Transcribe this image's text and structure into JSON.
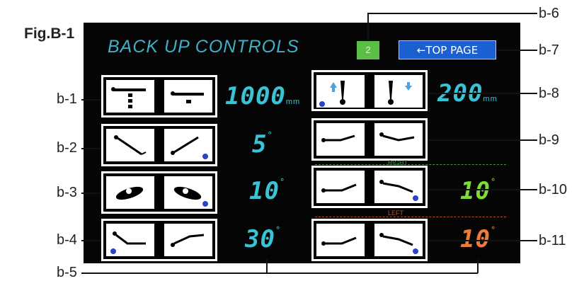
{
  "figure_label": "Fig.B-1",
  "screen": {
    "title": "BACK UP CONTROLS",
    "page_number": "2",
    "top_page_button": "←TOP PAGE"
  },
  "values": {
    "height": {
      "value": "1000",
      "unit": "mm"
    },
    "height_right": {
      "value": "200",
      "unit": "mm"
    },
    "back": {
      "value": "5",
      "unit": "°"
    },
    "roll": {
      "value": "10",
      "unit": "°"
    },
    "leg": {
      "value": "30",
      "unit": "°"
    },
    "right_tilt": {
      "value": "10",
      "unit": "°",
      "label": "RIGHT"
    },
    "left_tilt": {
      "value": "10",
      "unit": "°",
      "label": "LEFT"
    }
  },
  "callouts": [
    "b-1",
    "b-2",
    "b-3",
    "b-4",
    "b-5",
    "b-6",
    "b-7",
    "b-8",
    "b-9",
    "b-10",
    "b-11"
  ],
  "colors": {
    "cyan": "#39c3d6",
    "green": "#7ddc3a",
    "orange": "#f07a3a",
    "blue_button": "#1b5fd0",
    "page_green": "#5cbf45",
    "marker": "#2a44c8"
  }
}
